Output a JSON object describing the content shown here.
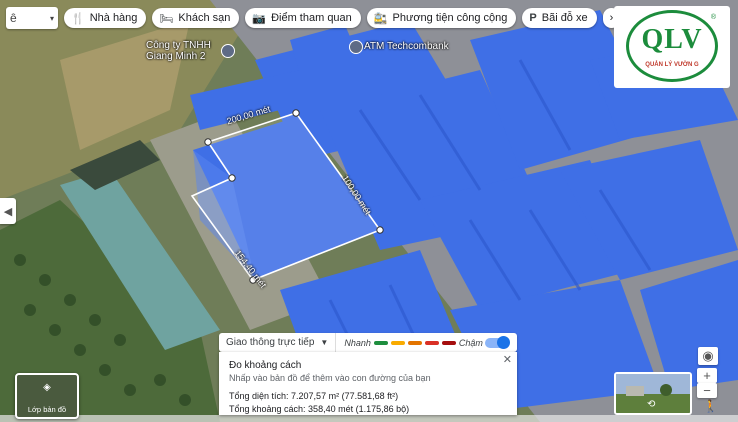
{
  "toolbar": {
    "search_glyph": "ê",
    "chips": [
      {
        "label": "Nhà hàng",
        "icon": "restaurant-icon"
      },
      {
        "label": "Khách sạn",
        "icon": "hotel-icon"
      },
      {
        "label": "Điểm tham quan",
        "icon": "attraction-icon"
      },
      {
        "label": "Phương tiện công cộng",
        "icon": "transit-icon"
      },
      {
        "label": "Bãi đỗ xe",
        "icon": "parking-icon"
      }
    ],
    "more_icon": "chevron-right-icon"
  },
  "logo": {
    "text": "QLV",
    "subtitle": "QUẢN LÝ VƯỜN G"
  },
  "map": {
    "pois": [
      {
        "label": "Công ty TNHH",
        "label2": "Giang Minh 2"
      },
      {
        "label": "ATM Techcombank"
      }
    ],
    "distance_labels": [
      "200,00 mét",
      "100,00 mét",
      "154,40 mét"
    ]
  },
  "traffic": {
    "mode_label": "Giao thông trực tiếp",
    "fast_label": "Nhanh",
    "slow_label": "Chậm",
    "colors": [
      "#1e8e3e",
      "#f9ab00",
      "#e37400",
      "#d93025",
      "#a50e0e"
    ]
  },
  "measure": {
    "title": "Đo khoảng cách",
    "hint": "Nhấp vào bản đồ để thêm vào con đường của bạn",
    "area": "Tổng diện tích: 7.207,57 m² (77.581,68 ft²)",
    "distance": "Tổng khoảng cách: 358,40 mét (1.175,86 bộ)"
  },
  "layers": {
    "label": "Lớp bản đồ"
  },
  "colors": {
    "roof": "#3f6fe6",
    "roof_light": "#5a86ef",
    "accent": "#1a73e8"
  }
}
